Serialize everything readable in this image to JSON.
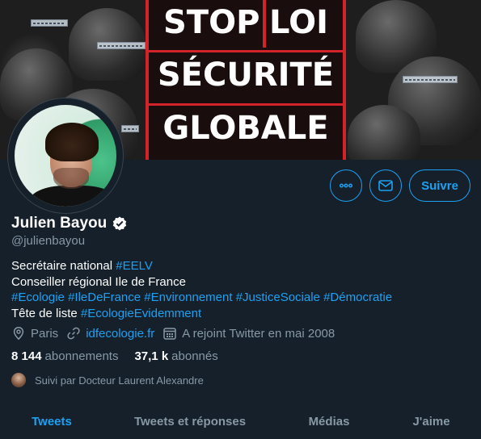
{
  "banner": {
    "poster_words": [
      "STOP",
      "LOI",
      "SÉCURITÉ",
      "GLOBALE"
    ],
    "visor_tags": [
      "NO GOMMES",
      "NO GOMMES",
      "NO GOMMES",
      "NO GOMMES"
    ]
  },
  "actions": {
    "more_icon": "more-icon",
    "message_icon": "envelope-icon",
    "follow_label": "Suivre"
  },
  "profile": {
    "name": "Julien Bayou",
    "verified_icon": "verified-badge-icon",
    "handle": "@julienbayou",
    "bio": {
      "line1_text": "Secrétaire national ",
      "line1_link": "#EELV",
      "line2_text": "Conseiller régional Ile de France",
      "line3_tags": [
        "#Ecologie",
        "#IleDeFrance",
        "#Environnement",
        "#JusticeSociale",
        "#Démocratie"
      ],
      "line4_text": "Tête de liste ",
      "line4_link": "#EcologieEvidemment"
    },
    "location": "Paris",
    "website": "idfecologie.fr",
    "joined": "A rejoint Twitter en mai 2008",
    "following_count": "8 144",
    "following_label": "abonnements",
    "followers_count": "37,1 k",
    "followers_label": "abonnés",
    "followed_by": "Suivi par Docteur Laurent Alexandre"
  },
  "tabs": [
    {
      "label": "Tweets",
      "active": true
    },
    {
      "label": "Tweets et réponses",
      "active": false
    },
    {
      "label": "Médias",
      "active": false
    },
    {
      "label": "J'aime",
      "active": false
    }
  ],
  "colors": {
    "background": "#15202b",
    "accent": "#1da1f2",
    "secondary_text": "#8899a6",
    "poster_red": "#d2232a"
  }
}
